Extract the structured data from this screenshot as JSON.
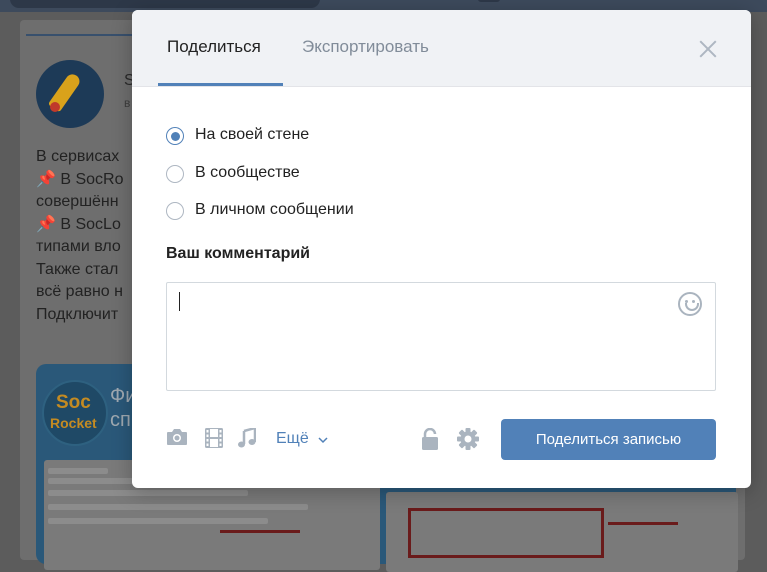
{
  "background": {
    "author_name_fragment": "S",
    "author_sub_fragment": "в",
    "post_lines": [
      {
        "pin": false,
        "text": "В сервисах"
      },
      {
        "pin": true,
        "text": " В SocRo"
      },
      {
        "pin": false,
        "text": "совершённ"
      },
      {
        "pin": true,
        "text": " В SocLo"
      },
      {
        "pin": false,
        "text": "типами вло"
      },
      {
        "pin": false,
        "text": "Также стал"
      },
      {
        "pin": false,
        "text": "всё равно н"
      },
      {
        "pin": false,
        "text": "Подключит"
      }
    ],
    "banner_logo_line1": "Soc",
    "banner_logo_line2": "Rocket",
    "banner_heading_line1": "Фи",
    "banner_heading_line2": "сп"
  },
  "modal": {
    "tabs": [
      {
        "label": "Поделиться",
        "active": true
      },
      {
        "label": "Экспортировать",
        "active": false
      }
    ],
    "share_targets": [
      {
        "label": "На своей стене",
        "checked": true
      },
      {
        "label": "В сообществе",
        "checked": false
      },
      {
        "label": "В личном сообщении",
        "checked": false
      }
    ],
    "comment_label": "Ваш комментарий",
    "comment_value": "",
    "toolbar": {
      "icons": [
        "camera-icon",
        "video-icon",
        "audio-icon",
        "lock-icon",
        "gear-icon"
      ],
      "more_label": "Ещё"
    },
    "submit_label": "Поделиться записью"
  },
  "colors": {
    "accent": "#5181b8",
    "header_bg": "#f0f2f5",
    "muted_icon": "#aeb7c2"
  }
}
